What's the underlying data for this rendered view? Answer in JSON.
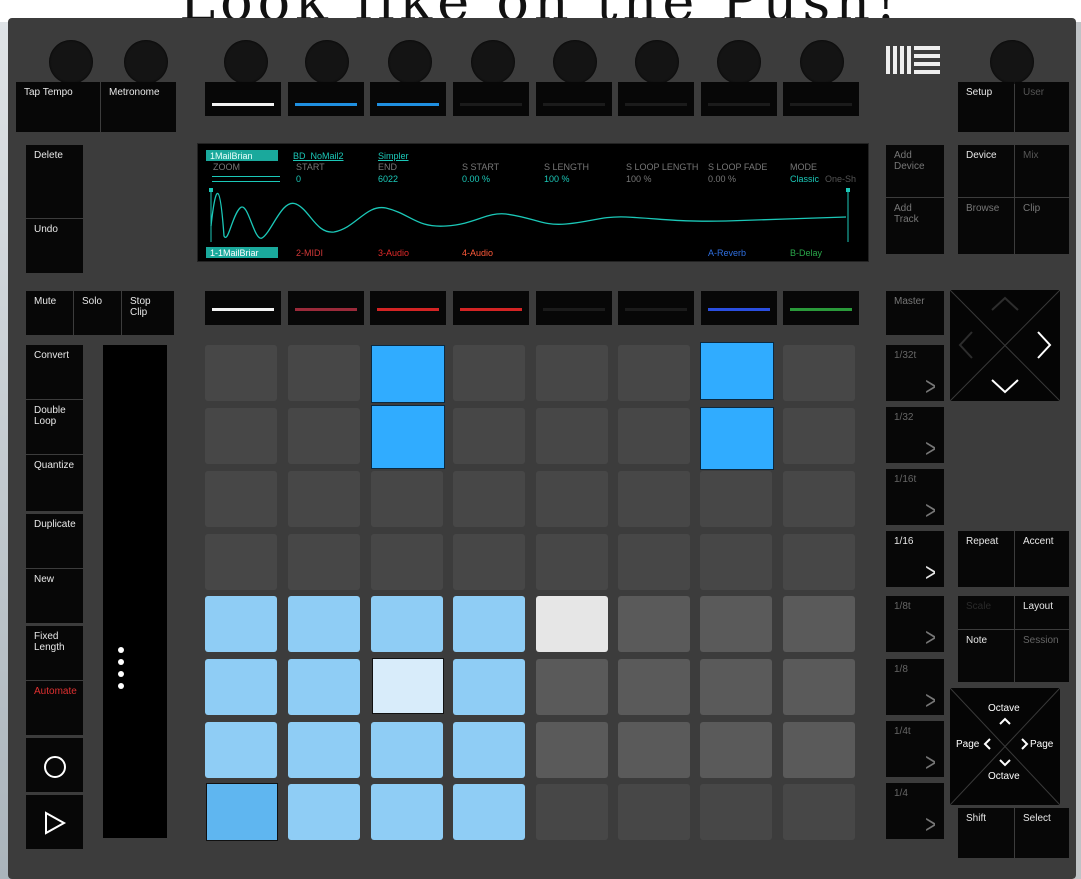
{
  "banner": {
    "text": "Look like on the Push!"
  },
  "logo": {
    "icon": "ableton-logo-icon"
  },
  "left_buttons": {
    "tap_tempo": "Tap Tempo",
    "metronome": "Metronome",
    "delete": "Delete",
    "undo": "Undo",
    "mute": "Mute",
    "solo": "Solo",
    "stop_clip": "Stop\nClip",
    "convert": "Convert",
    "double_loop": "Double\nLoop",
    "quantize": "Quantize",
    "duplicate": "Duplicate",
    "new": "New",
    "fixed_length": "Fixed\nLength",
    "automate": "Automate"
  },
  "transport": {
    "record_icon": "record-icon",
    "play_icon": "play-icon"
  },
  "right_buttons": {
    "add_device": "Add\nDevice",
    "add_track": "Add\nTrack",
    "master": "Master",
    "setup": "Setup",
    "user": "User",
    "device": "Device",
    "mix": "Mix",
    "browse": "Browse",
    "clip": "Clip",
    "repeat": "Repeat",
    "accent": "Accent",
    "scale": "Scale",
    "layout": "Layout",
    "note": "Note",
    "session": "Session",
    "shift": "Shift",
    "select": "Select"
  },
  "octave_pad": {
    "octave_up": "Octave",
    "octave_down": "Octave",
    "page_left": "Page",
    "page_right": "Page"
  },
  "scene_buttons": [
    {
      "label": "1/32t",
      "active": false
    },
    {
      "label": "1/32",
      "active": false
    },
    {
      "label": "1/16t",
      "active": false
    },
    {
      "label": "1/16",
      "active": true
    },
    {
      "label": "1/8t",
      "active": false
    },
    {
      "label": "1/8",
      "active": false
    },
    {
      "label": "1/4t",
      "active": false
    },
    {
      "label": "1/4",
      "active": false
    }
  ],
  "display": {
    "track": "1MailBrian",
    "clip": "BD_NoMail2",
    "device": "Simpler",
    "params": [
      {
        "label": "ZOOM",
        "value": ""
      },
      {
        "label": "START",
        "value": "0"
      },
      {
        "label": "END",
        "value": "6022"
      },
      {
        "label": "S START",
        "value": "0.00 %"
      },
      {
        "label": "S LENGTH",
        "value": "100 %"
      },
      {
        "label": "S LOOP LENGTH",
        "value": "100 %"
      },
      {
        "label": "S LOOP FADE",
        "value": "0.00 %"
      },
      {
        "label": "MODE",
        "value": "Classic",
        "value2": "One-Sh"
      }
    ],
    "tracks": [
      {
        "name": "1-1MailBriar",
        "color": "#ffffff"
      },
      {
        "name": "2-MIDI",
        "color": "#d03838"
      },
      {
        "name": "3-Audio",
        "color": "#e02a2a"
      },
      {
        "name": "4-Audio",
        "color": "#ff5a3a"
      },
      {
        "name": "",
        "color": ""
      },
      {
        "name": "",
        "color": ""
      },
      {
        "name": "A-Reverb",
        "color": "#2f6fe0"
      },
      {
        "name": "B-Delay",
        "color": "#2aa84a"
      }
    ]
  },
  "colors": {
    "accent": "#2ab0ff",
    "panel": "#3c3c3c",
    "display_teal": "#1bc8b8"
  }
}
